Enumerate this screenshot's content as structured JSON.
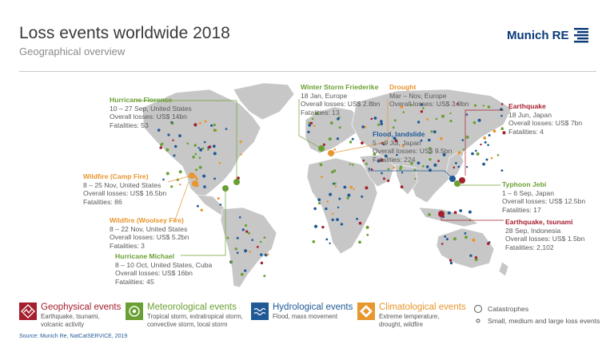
{
  "header": {
    "title": "Loss events worldwide 2018",
    "subtitle": "Geographical overview",
    "logo_text": "Munich RE"
  },
  "callouts": [
    {
      "id": "florence",
      "category": "meteorological",
      "title": "Hurricane Florence",
      "lines": [
        "10 – 27 Sep, United States",
        "Overall losses: US$ 14bn",
        "Fatalities: 53"
      ]
    },
    {
      "id": "friederike",
      "category": "meteorological",
      "title": "Winter Storm Friederike",
      "lines": [
        "18 Jan, Europe",
        "Overall losses: US$ 2.8bn",
        "Fatalities: 13"
      ]
    },
    {
      "id": "drought",
      "category": "climatological",
      "title": "Drought",
      "lines": [
        "Mar – Nov, Europe",
        "Overall losses: US$ 3.9bn"
      ]
    },
    {
      "id": "earthquake_japan",
      "category": "geophysical",
      "title": "Earthquake",
      "lines": [
        "18 Jun, Japan",
        "Overall losses: US$ 7bn",
        "Fatalities: 4"
      ]
    },
    {
      "id": "flood_japan",
      "category": "hydrological",
      "title": "Flood, landslide",
      "lines": [
        "5 – 9 Jul, Japan",
        "Overall losses: US$ 9.5bn",
        "Fatalities: 224"
      ]
    },
    {
      "id": "camp_fire",
      "category": "climatological",
      "title": "Wildfire (Camp Fire)",
      "lines": [
        "8 – 25 Nov, United States",
        "Overall losses: US$ 16.5bn",
        "Fatalities: 86"
      ]
    },
    {
      "id": "typhoon_jebi",
      "category": "meteorological",
      "title": "Typhoon Jebi",
      "lines": [
        "1 – 6 Sep, Japan",
        "Overall losses: US$ 12.5bn",
        "Fatalities: 17"
      ]
    },
    {
      "id": "woolsey",
      "category": "climatological",
      "title": "Wildfire (Woolsey Fire)",
      "lines": [
        "8 – 22 Nov, United States",
        "Overall losses: US$ 5.2bn",
        "Fatalities: 3"
      ]
    },
    {
      "id": "eq_tsunami",
      "category": "geophysical",
      "title": "Earthquake, tsunami",
      "lines": [
        "28 Sep, Indonesia",
        "Overall losses: US$ 1.5bn",
        "Fatalities: 2,102"
      ]
    },
    {
      "id": "michael",
      "category": "meteorological",
      "title": "Hurricane Michael",
      "lines": [
        "8 – 10 Oct, United States, Cuba",
        "Overall losses: US$ 16bn",
        "Fatalities: 45"
      ]
    }
  ],
  "legend": [
    {
      "id": "geophysical",
      "title": "Geophysical events",
      "lines": [
        "Earthquake, tsunami,",
        "volcanic activity"
      ],
      "color": "#a5202e",
      "icon": "zigzag-icon"
    },
    {
      "id": "meteorological",
      "title": "Meteorological events",
      "lines": [
        "Tropical storm, extratropical storm,",
        "convective storm, local storm"
      ],
      "color": "#6aa033",
      "icon": "swirl-icon"
    },
    {
      "id": "hydrological",
      "title": "Hydrological events",
      "lines": [
        "Flood, mass movement"
      ],
      "color": "#1f5a96",
      "icon": "wave-icon"
    },
    {
      "id": "climatological",
      "title": "Climatological events",
      "lines": [
        "Extreme temperature,",
        "drought, wildfire"
      ],
      "color": "#e8962e",
      "icon": "sun-icon"
    }
  ],
  "legend_size": {
    "catastrophes": "Catastrophes",
    "small": "Small, medium and large loss events"
  },
  "colors": {
    "geophysical": "#a5202e",
    "meteorological": "#6aa033",
    "hydrological": "#1f5a96",
    "climatological": "#e8962e",
    "land": "#c7c7c7"
  },
  "source": "Source: Munich Re, NatCatSERVICE, 2019"
}
